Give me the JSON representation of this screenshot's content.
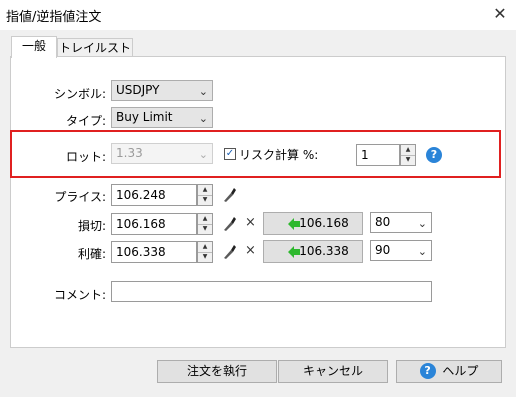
{
  "window": {
    "title": "指値/逆指値注文",
    "close_glyph": "✕"
  },
  "tabs": [
    {
      "label": "一般"
    },
    {
      "label": "トレイルストップ"
    }
  ],
  "form": {
    "symbol": {
      "label": "シンボル:",
      "value": "USDJPY"
    },
    "type": {
      "label": "タイプ:",
      "value": "Buy Limit"
    },
    "lot": {
      "label": "ロット:",
      "value": "1.33"
    },
    "risk": {
      "checkbox_label": "リスク計算 %:",
      "checked": true,
      "value": "1"
    },
    "price": {
      "label": "プライス:",
      "value": "106.248"
    },
    "stoploss": {
      "label": "損切:",
      "value": "106.168",
      "button_value": "106.168",
      "points": "80"
    },
    "takeprofit": {
      "label": "利確:",
      "value": "106.338",
      "button_value": "106.338",
      "points": "90"
    },
    "comment": {
      "label": "コメント:",
      "value": ""
    }
  },
  "buttons": {
    "execute": "注文を執行",
    "cancel": "キャンセル",
    "help": "ヘルプ"
  },
  "icons": {
    "close": "close-icon",
    "chevron": "chevron-down-icon",
    "help": "help-icon",
    "pipette": "pipette-icon",
    "multiply": "×",
    "arrow": "green-left-arrow-icon"
  },
  "colors": {
    "highlight_border": "#e02020",
    "arrow_green": "#2eb82e",
    "help_blue": "#2a84d8"
  }
}
